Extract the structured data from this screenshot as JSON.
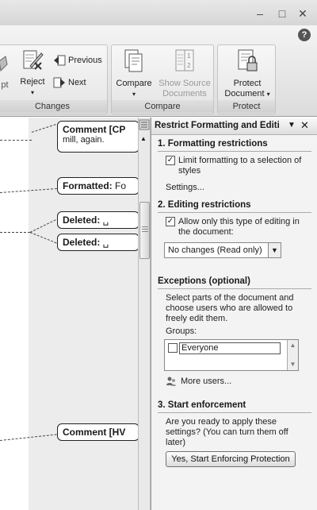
{
  "window": {
    "minimize": "–",
    "restore": "□",
    "close": "✕",
    "help": "?"
  },
  "ribbon": {
    "changes": {
      "accept_partial": "pt",
      "reject_label": "Reject",
      "previous_label": "Previous",
      "next_label": "Next",
      "group_label": "Changes"
    },
    "compare": {
      "compare_label": "Compare",
      "show_source_line1": "Show Source",
      "show_source_line2": "Documents",
      "group_label": "Compare"
    },
    "protect": {
      "protect_line1": "Protect",
      "protect_line2": "Document",
      "group_label": "Protect"
    }
  },
  "document": {
    "balloons": [
      {
        "label": "Comment [CP",
        "body": "mill, again."
      },
      {
        "label": "Formatted:",
        "body": " Fo"
      },
      {
        "label": "Deleted:",
        "body": " ␣"
      },
      {
        "label": "Deleted:",
        "body": " ␣"
      },
      {
        "label": "Comment [HV",
        "body": ""
      }
    ]
  },
  "pane": {
    "title": "Restrict Formatting and Editi",
    "section1": {
      "title": "1. Formatting restrictions",
      "checkbox_label_line1": "Limit formatting to a selection of",
      "checkbox_label_line2": "styles",
      "checked": true,
      "settings_link": "Settings..."
    },
    "section2": {
      "title": "2. Editing restrictions",
      "checkbox_label_line1": "Allow only this type of editing in",
      "checkbox_label_line2": "the document:",
      "checked": true,
      "select_value": "No changes (Read only)"
    },
    "exceptions": {
      "title": "Exceptions (optional)",
      "desc_line1": "Select parts of the document and",
      "desc_line2": "choose users who are allowed to",
      "desc_line3": "freely edit them.",
      "groups_label": "Groups:",
      "group_item": "Everyone",
      "more_users": "More users..."
    },
    "section3": {
      "title": "3. Start enforcement",
      "desc_line1": "Are you ready to apply these",
      "desc_line2": "settings? (You can turn them off",
      "desc_line3": "later)",
      "button_label": "Yes, Start Enforcing Protection"
    }
  }
}
